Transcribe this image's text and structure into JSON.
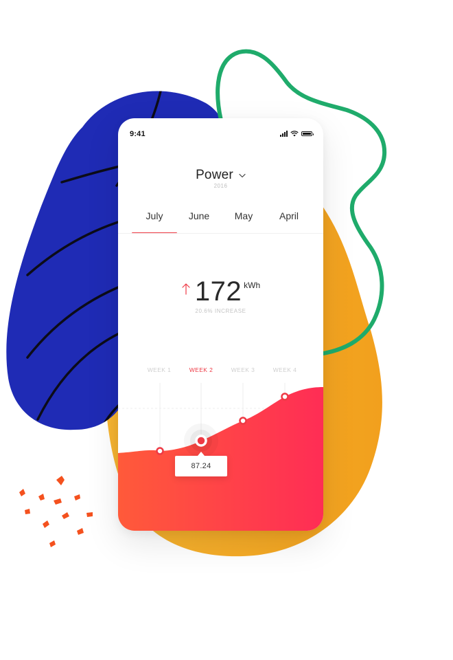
{
  "status_bar": {
    "time": "9:41"
  },
  "header": {
    "title": "Power",
    "year": "2016"
  },
  "tabs": [
    {
      "label": "July",
      "active": true
    },
    {
      "label": "June",
      "active": false
    },
    {
      "label": "May",
      "active": false
    },
    {
      "label": "April",
      "active": false
    }
  ],
  "metric": {
    "value": "172",
    "unit": "kWh",
    "subtitle": "20.6% INCREASE",
    "trend": "up"
  },
  "weeks": [
    {
      "label": "WEEK 1",
      "active": false
    },
    {
      "label": "WEEK 2",
      "active": true
    },
    {
      "label": "WEEK 3",
      "active": false
    },
    {
      "label": "WEEK 4",
      "active": false
    }
  ],
  "tooltip": {
    "value": "87.24"
  },
  "colors": {
    "accent": "#ee3a45",
    "gradient_start": "#ff5a3a",
    "gradient_end": "#ff2d55",
    "blob_blue": "#1f2bb5",
    "blob_yellow": "#f5a623",
    "loop_green": "#1fab6b",
    "confetti_orange": "#f4511e"
  },
  "icons": [
    "chevron-down-icon",
    "up-arrow-icon",
    "signal-icon",
    "wifi-icon",
    "battery-icon"
  ]
}
